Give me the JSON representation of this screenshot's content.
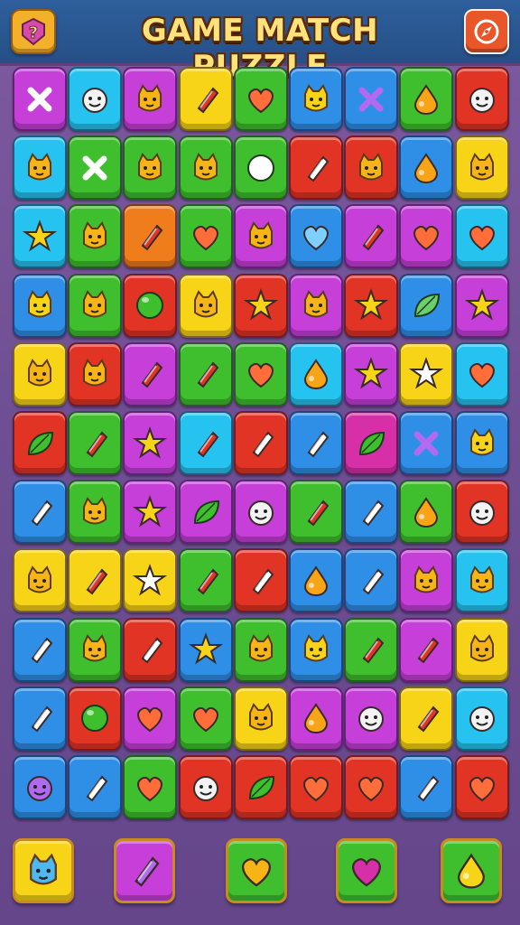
{
  "header": {
    "title": "GAME MATCH PUZZLE",
    "left_button_icon": "question-badge-icon",
    "right_button_icon": "compass-icon"
  },
  "palette": {
    "B": "#2f8fe6",
    "C": "#27c3f0",
    "P": "#c63fd9",
    "Y": "#f7d417",
    "G": "#3fbf2e",
    "R": "#e23424",
    "O": "#f07d1c",
    "V": "#8a3fd0",
    "M": "#d62fa8"
  },
  "board": {
    "rows": [
      [
        [
          "P",
          "x"
        ],
        [
          "C",
          "face"
        ],
        [
          "P",
          "cat"
        ],
        [
          "Y",
          "gem"
        ],
        [
          "G",
          "heart"
        ],
        [
          "B",
          "cat"
        ],
        [
          "B",
          "x"
        ],
        [
          "G",
          "drop"
        ],
        [
          "R",
          "face"
        ]
      ],
      [
        [
          "C",
          "cat"
        ],
        [
          "G",
          "x"
        ],
        [
          "G",
          "cat"
        ],
        [
          "G",
          "cat"
        ],
        [
          "G",
          "ball"
        ],
        [
          "R",
          "gem"
        ],
        [
          "R",
          "cat"
        ],
        [
          "B",
          "drop"
        ],
        [
          "Y",
          "cat"
        ]
      ],
      [
        [
          "C",
          "star"
        ],
        [
          "G",
          "cat"
        ],
        [
          "O",
          "gem"
        ],
        [
          "G",
          "heart"
        ],
        [
          "P",
          "cat"
        ],
        [
          "B",
          "heart"
        ],
        [
          "P",
          "gem"
        ],
        [
          "P",
          "heart"
        ],
        [
          "C",
          "heart"
        ]
      ],
      [
        [
          "B",
          "cat"
        ],
        [
          "G",
          "cat"
        ],
        [
          "R",
          "ball"
        ],
        [
          "Y",
          "cat"
        ],
        [
          "R",
          "star"
        ],
        [
          "P",
          "cat"
        ],
        [
          "R",
          "star"
        ],
        [
          "B",
          "leaf"
        ],
        [
          "P",
          "star"
        ]
      ],
      [
        [
          "Y",
          "cat"
        ],
        [
          "R",
          "cat"
        ],
        [
          "P",
          "gem"
        ],
        [
          "G",
          "gem"
        ],
        [
          "G",
          "heart"
        ],
        [
          "C",
          "drop"
        ],
        [
          "P",
          "star"
        ],
        [
          "Y",
          "star"
        ],
        [
          "C",
          "heart"
        ]
      ],
      [
        [
          "R",
          "leaf"
        ],
        [
          "G",
          "gem"
        ],
        [
          "P",
          "star"
        ],
        [
          "C",
          "gem"
        ],
        [
          "R",
          "gem"
        ],
        [
          "B",
          "gem"
        ],
        [
          "M",
          "leaf"
        ],
        [
          "B",
          "x"
        ],
        [
          "B",
          "cat"
        ]
      ],
      [
        [
          "B",
          "gem"
        ],
        [
          "G",
          "cat"
        ],
        [
          "P",
          "star"
        ],
        [
          "P",
          "leaf"
        ],
        [
          "P",
          "face"
        ],
        [
          "G",
          "gem"
        ],
        [
          "B",
          "gem"
        ],
        [
          "G",
          "drop"
        ],
        [
          "R",
          "face"
        ]
      ],
      [
        [
          "Y",
          "cat"
        ],
        [
          "Y",
          "gem"
        ],
        [
          "Y",
          "star"
        ],
        [
          "G",
          "gem"
        ],
        [
          "R",
          "gem"
        ],
        [
          "B",
          "drop"
        ],
        [
          "B",
          "gem"
        ],
        [
          "P",
          "cat"
        ],
        [
          "C",
          "cat"
        ]
      ],
      [
        [
          "B",
          "gem"
        ],
        [
          "G",
          "cat"
        ],
        [
          "R",
          "gem"
        ],
        [
          "B",
          "star"
        ],
        [
          "G",
          "cat"
        ],
        [
          "B",
          "cat"
        ],
        [
          "G",
          "gem"
        ],
        [
          "P",
          "gem"
        ],
        [
          "Y",
          "cat"
        ]
      ],
      [
        [
          "B",
          "gem"
        ],
        [
          "R",
          "ball"
        ],
        [
          "P",
          "heart"
        ],
        [
          "G",
          "heart"
        ],
        [
          "Y",
          "cat"
        ],
        [
          "P",
          "drop"
        ],
        [
          "P",
          "face"
        ],
        [
          "Y",
          "gem"
        ],
        [
          "C",
          "face"
        ]
      ],
      [
        [
          "B",
          "face"
        ],
        [
          "B",
          "gem"
        ],
        [
          "G",
          "heart"
        ],
        [
          "R",
          "face"
        ],
        [
          "R",
          "leaf"
        ],
        [
          "R",
          "heart"
        ],
        [
          "R",
          "heart"
        ],
        [
          "B",
          "gem"
        ],
        [
          "R",
          "heart"
        ]
      ]
    ]
  },
  "tray": {
    "items": [
      {
        "color": "#f7d417",
        "icon": "cat-icon",
        "glyph": "cat"
      },
      {
        "color": "#c63fd9",
        "icon": "gem-icon",
        "glyph": "gem"
      },
      {
        "color": "#3fbf2e",
        "icon": "heart-icon",
        "glyph": "heart"
      },
      {
        "color": "#3fbf2e",
        "icon": "heart-icon",
        "glyph": "heart"
      },
      {
        "color": "#3fbf2e",
        "icon": "drop-icon",
        "glyph": "drop"
      }
    ]
  }
}
